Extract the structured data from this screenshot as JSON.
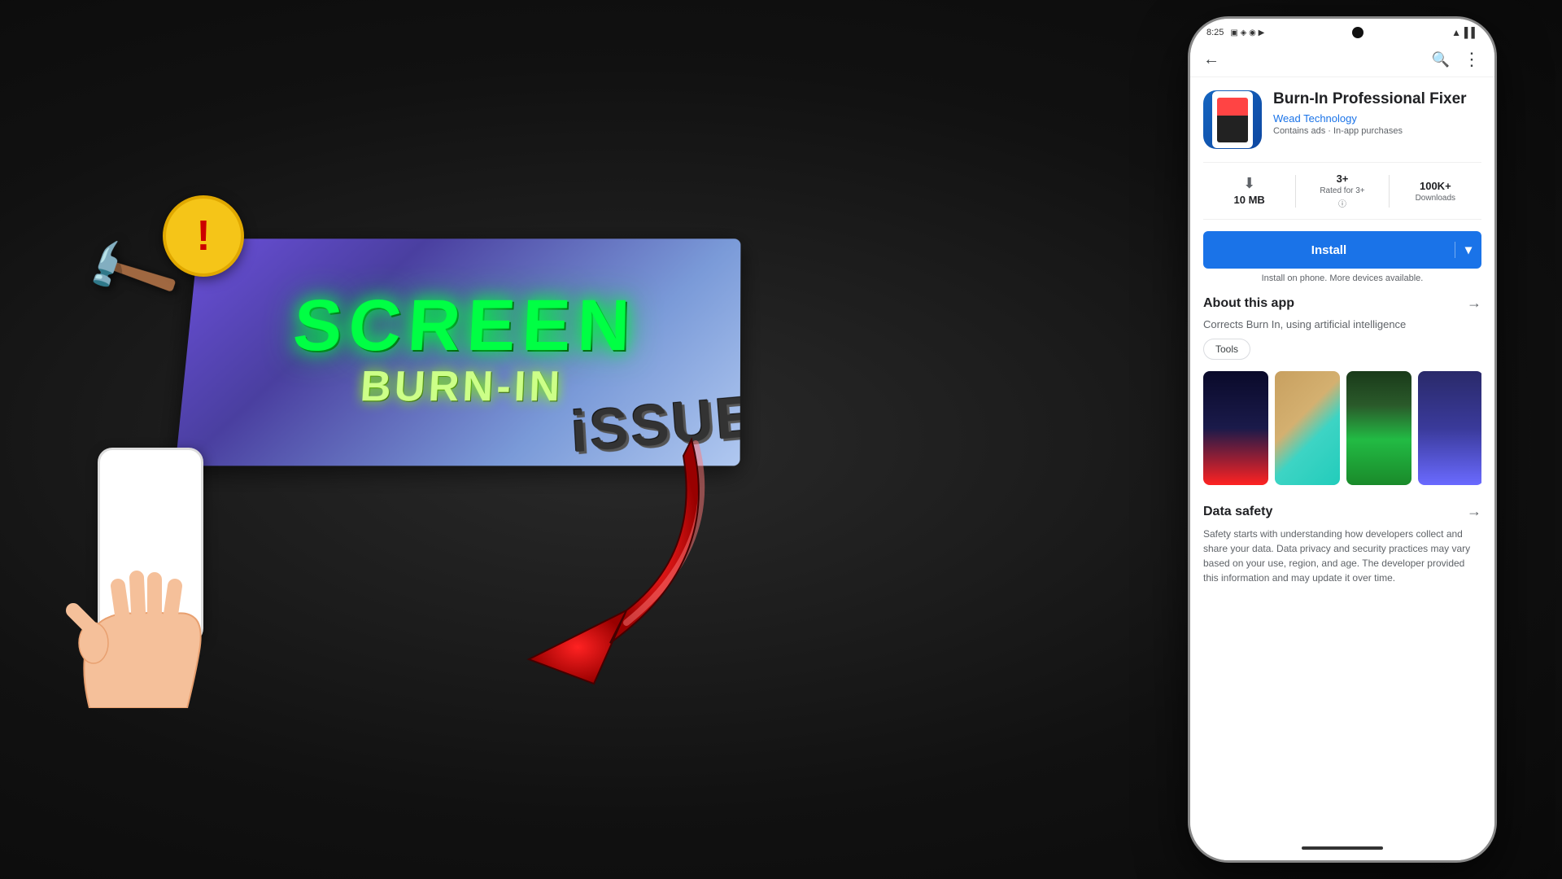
{
  "background": {
    "color": "#1a1a1a"
  },
  "left_panel": {
    "title_line1": "SCREEN",
    "title_line2": "BURN-IN",
    "title_line3": "iSSUE",
    "warning_symbol": "!",
    "hammer_emoji": "🔨"
  },
  "phone_mockup": {
    "status_bar": {
      "time": "8:25",
      "icons_left": "▣ ◈ ◉ ▶",
      "icons_right": "▲ ▌▌"
    },
    "toolbar": {
      "back_icon": "←",
      "search_icon": "🔍",
      "more_icon": "⋮"
    },
    "app": {
      "title": "Burn-In Professional Fixer",
      "developer": "Wead Technology",
      "tags": "Contains ads · In-app purchases",
      "stats": {
        "size": "10 MB",
        "size_label": "",
        "rating": "3+",
        "rating_label": "Rated for 3+",
        "downloads": "100K+",
        "downloads_label": "Downloads"
      },
      "install_button": "Install",
      "install_note": "Install on phone. More devices available.",
      "about_section": {
        "title": "About this app",
        "arrow": "→",
        "description": "Corrects Burn In, using artificial intelligence",
        "tag": "Tools"
      },
      "screenshots": [
        {
          "id": "ss1",
          "class": "ss1"
        },
        {
          "id": "ss2",
          "class": "ss2"
        },
        {
          "id": "ss3",
          "class": "ss3"
        },
        {
          "id": "ss4",
          "class": "ss4"
        }
      ],
      "data_safety": {
        "title": "Data safety",
        "arrow": "→",
        "text": "Safety starts with understanding how developers collect and share your data. Data privacy and security practices may vary based on your use, region, and age. The developer provided this information and may update it over time."
      }
    }
  }
}
